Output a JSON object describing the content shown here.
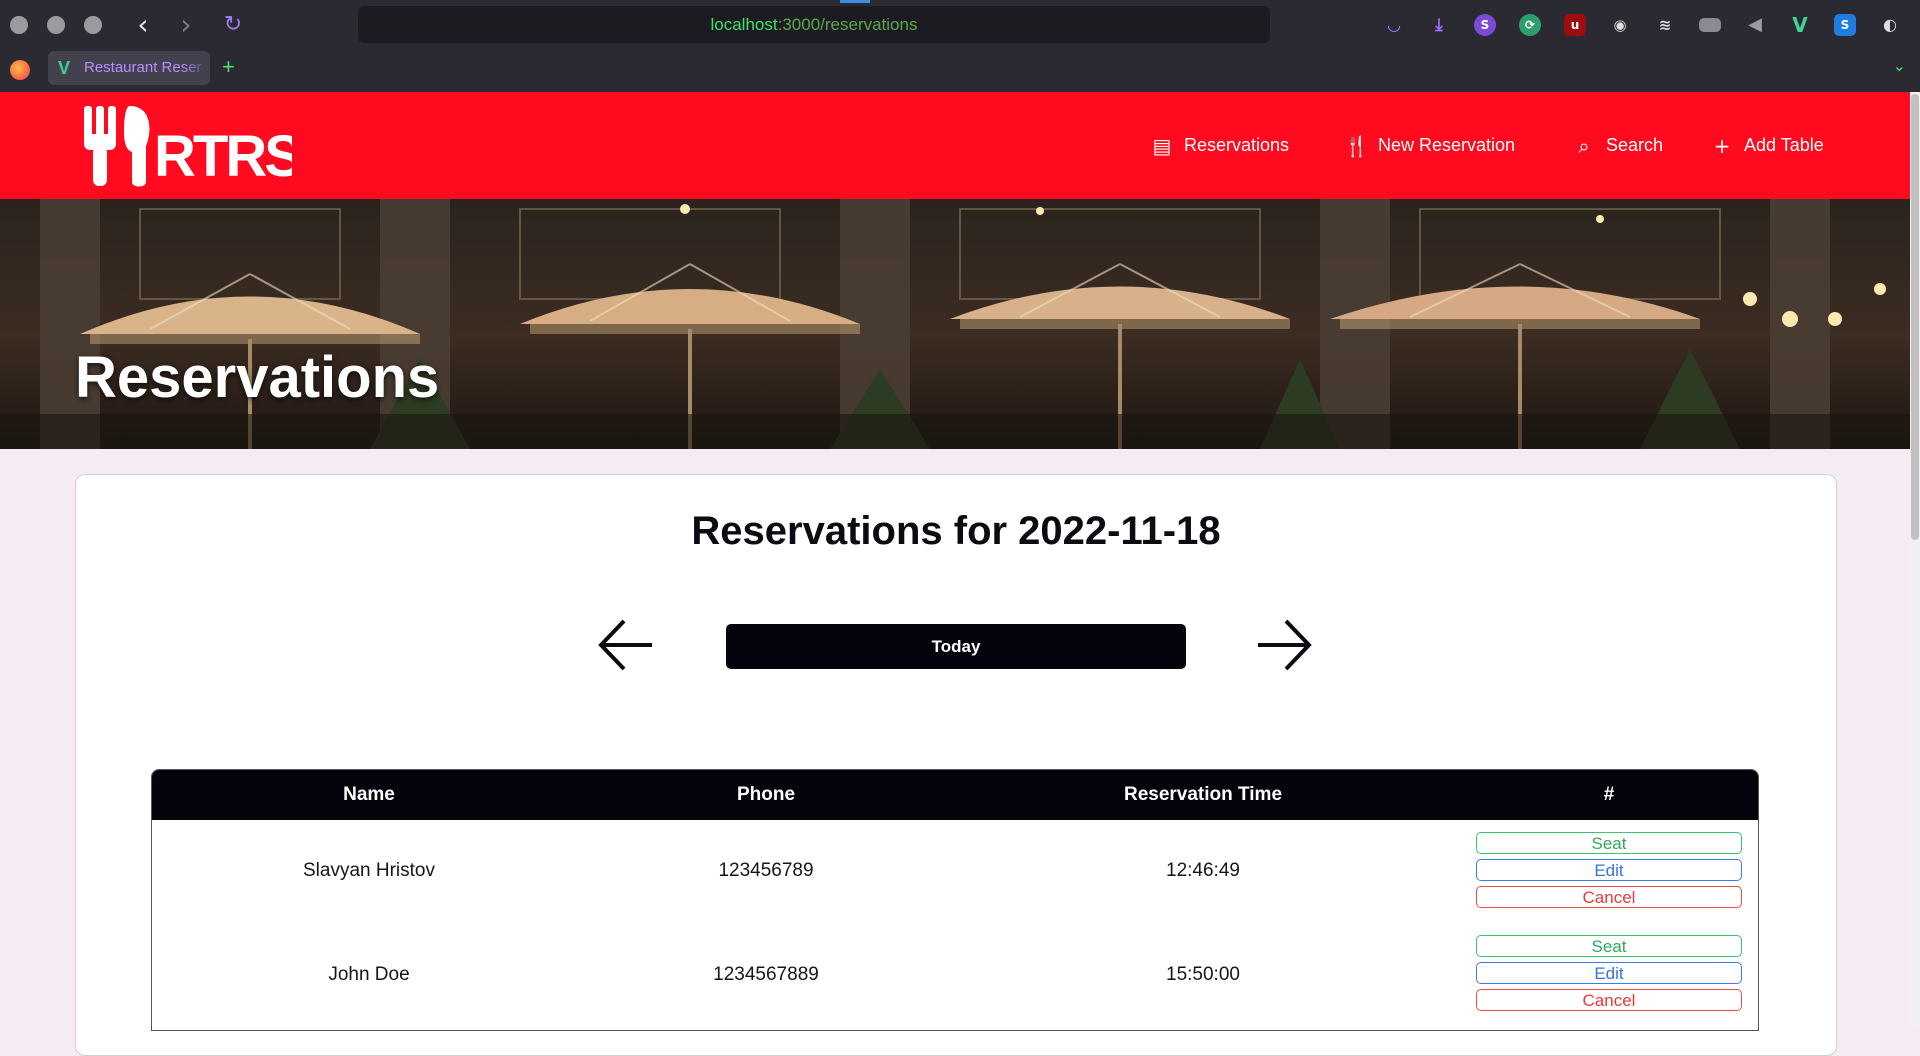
{
  "browser": {
    "url_host": "localhost",
    "url_path": ":3000/reservations",
    "tab_title": "Restaurant Reser",
    "new_tab": "+",
    "extensions": [
      "pocket-icon",
      "download-icon",
      "s-extension-icon",
      "sync-icon",
      "ublock-icon",
      "privacy-icon",
      "sloth-icon",
      "screen-icon",
      "volume-icon",
      "vue-devtools-icon",
      "s-blue-icon",
      "profile-icon"
    ]
  },
  "header": {
    "logo_text": "RTRS",
    "brand_color": "#ff0a1f",
    "nav": [
      {
        "label": "Reservations",
        "icon": "list-icon"
      },
      {
        "label": "New Reservation",
        "icon": "fork-knife-icon"
      },
      {
        "label": "Search",
        "icon": "search-icon"
      },
      {
        "label": "Add Table",
        "icon": "plus-icon"
      }
    ]
  },
  "hero": {
    "title": "Reservations"
  },
  "dashboard": {
    "title": "Reservations for 2022-11-18",
    "today_button": "Today",
    "columns": [
      "Name",
      "Phone",
      "Reservation Time",
      "#"
    ],
    "rows": [
      {
        "name": "Slavyan Hristov",
        "phone": "123456789",
        "time": "12:46:49"
      },
      {
        "name": "John Doe",
        "phone": "1234567889",
        "time": "15:50:00"
      }
    ],
    "actions": {
      "seat": "Seat",
      "edit": "Edit",
      "cancel": "Cancel"
    },
    "action_colors": {
      "seat": "#3cc36c",
      "edit": "#3f7be8",
      "cancel": "#f04a4a"
    }
  }
}
